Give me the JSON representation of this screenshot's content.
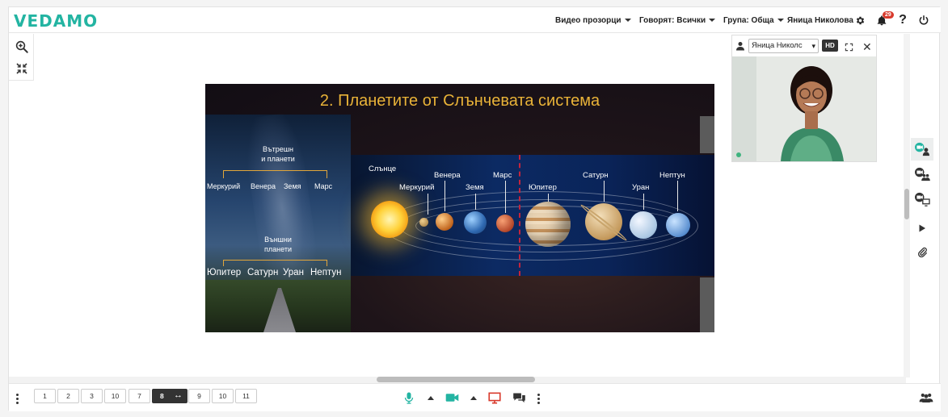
{
  "app": {
    "logo": "VEDAMO"
  },
  "header": {
    "video_windows": "Видео прозорци",
    "speaking": "Говорят: Всички",
    "group": "Група: Обща",
    "user_name": "Яница Николова",
    "notifications_count": "29"
  },
  "slide": {
    "title": "2. Планетите от Слънчевата система",
    "inner_planets_label_1": "Вътрешн",
    "inner_planets_label_2": "и планети",
    "inner_planets": [
      "Меркурий",
      "Венера",
      "Земя",
      "Марс"
    ],
    "outer_planets_label_1": "Външни",
    "outer_planets_label_2": "планети",
    "outer_planets": [
      "Юпитер",
      "Сатурн",
      "Уран",
      "Нептун"
    ],
    "diagram_labels": {
      "sun": "Слънце",
      "mercury": "Меркурий",
      "venus": "Венера",
      "earth": "Земя",
      "mars": "Марс",
      "jupiter": "Юпитер",
      "saturn": "Сатурн",
      "uranus": "Уран",
      "neptune": "Нептун"
    }
  },
  "video": {
    "participant": "Яница Николс",
    "hd_label": "HD"
  },
  "pagination": {
    "pages": [
      "1",
      "2",
      "3",
      "10",
      "7",
      "8",
      "9",
      "10",
      "11"
    ],
    "active_index": 5
  },
  "colors": {
    "brand": "#23b4a2",
    "mic": "#23b4a2",
    "camera": "#23b4a2",
    "screen_share": "#d8392b",
    "badge": "#d83a2c",
    "slide_title": "#e9b338"
  }
}
